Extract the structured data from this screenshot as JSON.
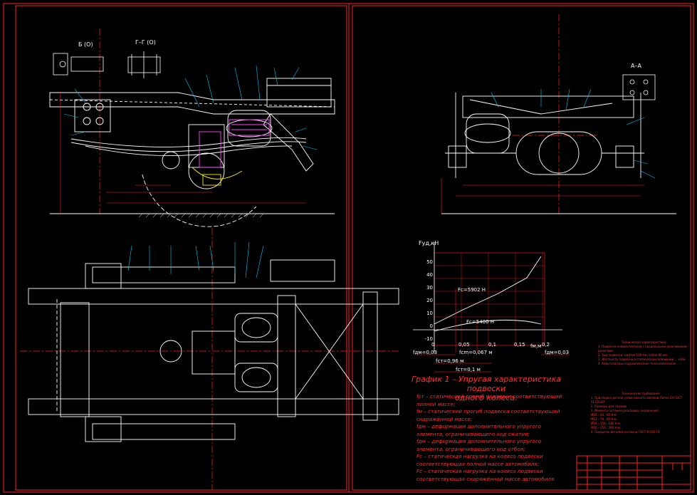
{
  "colors": {
    "background": "#000000",
    "frame": "#ff2020",
    "outline": "#ffffff",
    "dimension": "#00c8ff",
    "hatch": "#ff66ff",
    "highlight": "#ffee00"
  },
  "section_labels": {
    "b_b": "Б (О)",
    "g_g": "Г–Г (О)",
    "a_a": "А–А"
  },
  "graph": {
    "axis_y_label": "Fуд,кН",
    "y_ticks": [
      "50",
      "40",
      "30",
      "20",
      "10",
      "0",
      "-10"
    ],
    "x_ticks": [
      "0",
      "0,05",
      "0,1",
      "0,15",
      "0,2"
    ],
    "x_axis_label": "fм,м",
    "annotation_upper": "Fс=5902 Н",
    "annotation_lower": "Fс=5400 Н",
    "dim_left_start": "fдм=0,03",
    "dim_left_1": "fcm=0,067 м",
    "dim_left_2": "fcт=0,96 м",
    "dim_left_3": "fcт=0,1 м",
    "dim_right": "fдм=0,03",
    "title_line1": "График 1 – Упругая характеристика подвески",
    "title_line2": "одного колеса:"
  },
  "legend": [
    "fст – статический прогиб подвески соответствующий полной массе;",
    "fм – статический прогиб подвески соответствующий снаряжённой массе;",
    "fдм – деформация дополнительного упругого элемента, ограничивающего ход сжатия;",
    "fдм – деформация дополнительного упругого элемента, ограничивающего ход отбоя;",
    "Fс – статическая нагрузка на колесо подвески соответствующая полной массе автомобиля;",
    "Fс – статическая нагрузка на колесо подвески соответствующая снаряжённой массе автомобиля"
  ],
  "tech_notes": {
    "title1": "Техническая характеристика",
    "lines1": [
      "1. Подвеска пневматическая с продольными реактивными рычагами",
      "2. Ход подвески: сжатия 100 мм, отбоя 80 мм",
      "3. Жёсткость подвески в статическом положении ... кН/м",
      "4. Амортизаторы гидравлические телескопические"
    ],
    "title2": "Технические требования",
    "lines2": [
      "1. При сборке детали узлов смазать смазкой Литол-24 ГОСТ 21150-87",
      "2. Размеры для справок",
      "3. Моменты затяжки резьбовых соединений:",
      "М10 – 40...60 Н·м",
      "М12 – 70...90 Н·м",
      "М16 – 150...180 Н·м",
      "М20 – 250...300 Н·м",
      "4. Покрытие деталей согласно ГОСТ 9.032-74"
    ]
  },
  "title_block": {
    "cells": [
      "",
      "",
      "",
      "",
      "",
      ""
    ]
  }
}
